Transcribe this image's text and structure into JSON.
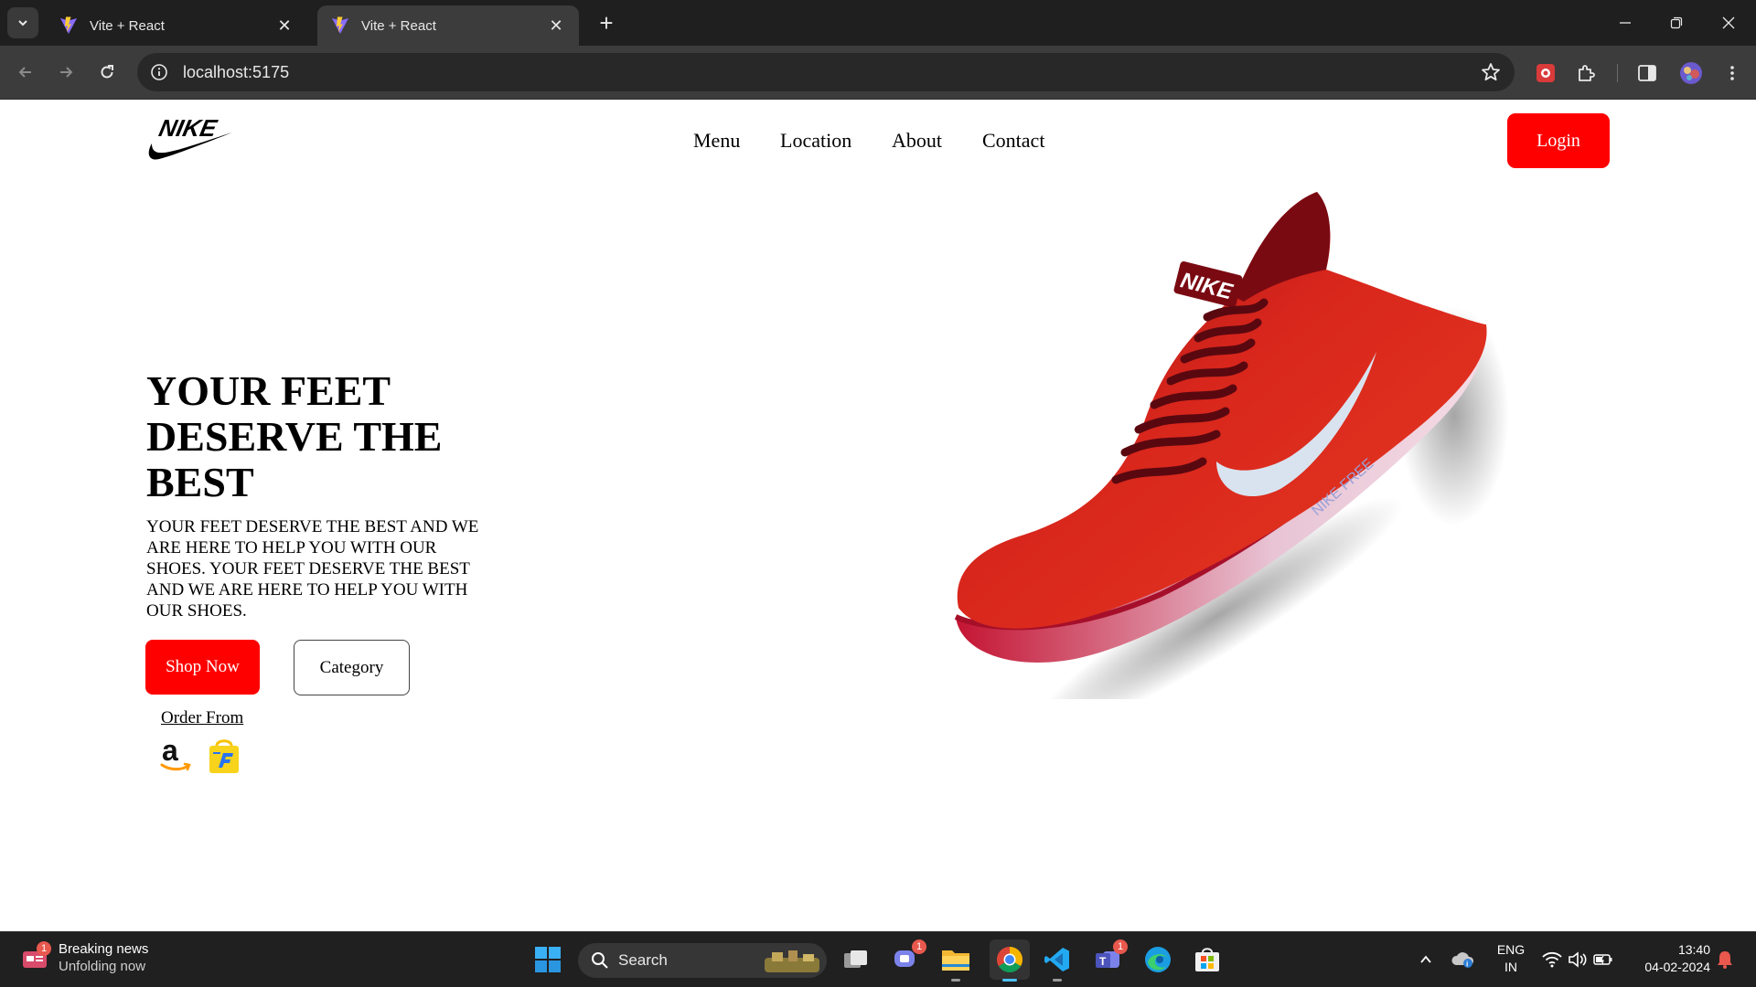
{
  "browser": {
    "tabs": [
      {
        "title": "Vite + React",
        "active": false
      },
      {
        "title": "Vite + React",
        "active": true
      }
    ],
    "url": "localhost:5175"
  },
  "site": {
    "brand": "NIKE",
    "nav": [
      "Menu",
      "Location",
      "About",
      "Contact"
    ],
    "login_label": "Login",
    "hero": {
      "title": "YOUR FEET DESERVE THE BEST",
      "description": "YOUR FEET DESERVE THE BEST AND WE ARE HERE TO HELP YOU WITH OUR SHOES. YOUR FEET DESERVE THE BEST AND WE ARE HERE TO HELP YOU WITH OUR SHOES.",
      "shop_label": "Shop Now",
      "category_label": "Category",
      "order_from": "Order From"
    },
    "shoe_print": {
      "brand": "NIKE",
      "side_text": "NIKE FREE"
    },
    "colors": {
      "accent": "#ff0000",
      "shoe": "#c4141a"
    }
  },
  "taskbar": {
    "news_title": "Breaking news",
    "news_sub": "Unfolding now",
    "news_badge": "1",
    "search_label": "Search",
    "chat_badge": "1",
    "teams_badge": "1",
    "lang_1": "ENG",
    "lang_2": "IN",
    "time": "13:40",
    "date": "04-02-2024"
  }
}
